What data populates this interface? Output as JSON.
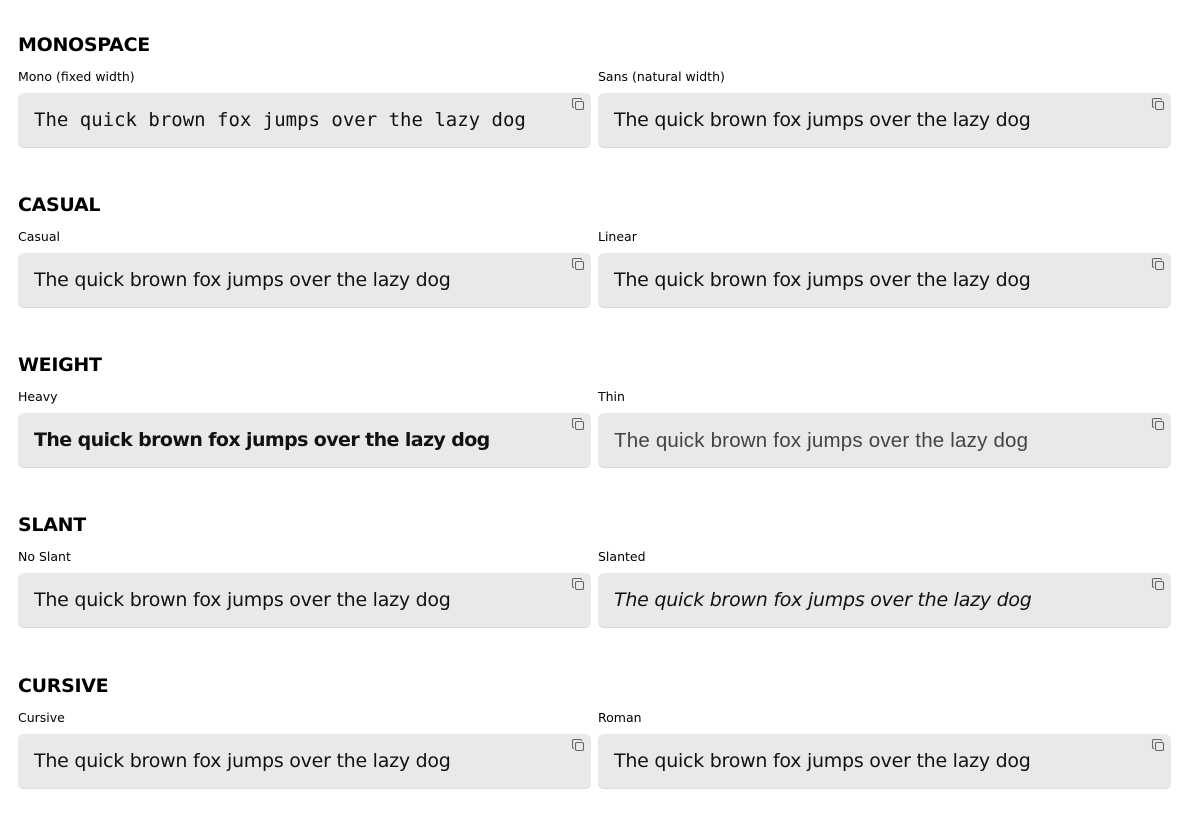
{
  "sections": [
    {
      "title": "MONOSPACE",
      "left": {
        "label": "Mono (fixed width)",
        "text": "The quick brown fox jumps over the lazy dog"
      },
      "right": {
        "label": "Sans (natural width)",
        "text": "The quick brown fox jumps over the lazy dog"
      }
    },
    {
      "title": "CASUAL",
      "left": {
        "label": "Casual",
        "text": "The quick brown fox jumps over the lazy dog"
      },
      "right": {
        "label": "Linear",
        "text": "The quick brown fox jumps over the lazy dog"
      }
    },
    {
      "title": "WEIGHT",
      "left": {
        "label": "Heavy",
        "text": "The quick brown fox jumps over the lazy dog"
      },
      "right": {
        "label": "Thin",
        "text": "The quick brown fox jumps over the lazy dog"
      }
    },
    {
      "title": "SLANT",
      "left": {
        "label": "No Slant",
        "text": "The quick brown fox jumps over the lazy dog"
      },
      "right": {
        "label": "Slanted",
        "text": "The quick brown fox jumps over the lazy dog"
      }
    },
    {
      "title": "CURSIVE",
      "left": {
        "label": "Cursive",
        "text": "The quick brown fox jumps over the lazy dog"
      },
      "right": {
        "label": "Roman",
        "text": "The quick brown fox jumps over the lazy dog"
      }
    }
  ],
  "icons": {
    "copy": "copy-icon"
  },
  "colors": {
    "box_background": "#e9e9e9",
    "text": "#111111"
  }
}
